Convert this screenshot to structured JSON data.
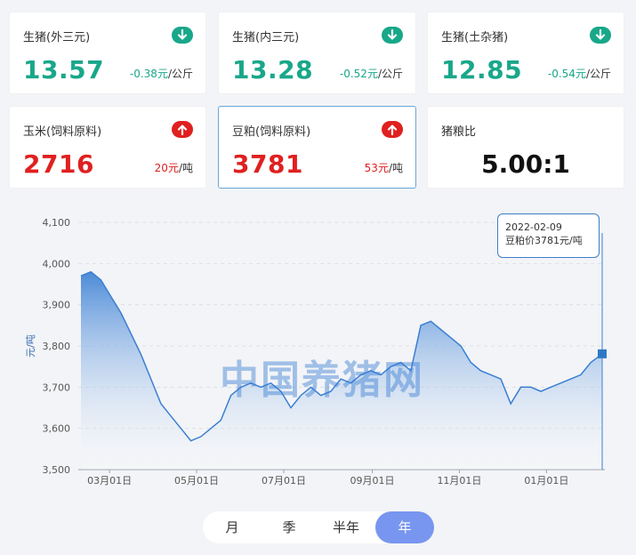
{
  "cards": [
    {
      "name": "生猪(外三元)",
      "value": "13.57",
      "change": "-0.38元",
      "unit": "/公斤",
      "trend": "down"
    },
    {
      "name": "生猪(内三元)",
      "value": "13.28",
      "change": "-0.52元",
      "unit": "/公斤",
      "trend": "down"
    },
    {
      "name": "生猪(土杂猪)",
      "value": "12.85",
      "change": "-0.54元",
      "unit": "/公斤",
      "trend": "down"
    },
    {
      "name": "玉米(饲料原料)",
      "value": "2716",
      "change": "20元",
      "unit": "/吨",
      "trend": "up"
    },
    {
      "name": "豆粕(饲料原料)",
      "value": "3781",
      "change": "53元",
      "unit": "/吨",
      "trend": "up"
    },
    {
      "name": "猪粮比",
      "value": "5.00:1"
    }
  ],
  "colors": {
    "down": "#19a78a",
    "up": "#e02020",
    "line": "#3a7fd3",
    "accent": "#7896ef"
  },
  "icons": {
    "down": "arrow-down-circle-icon",
    "up": "arrow-up-circle-icon"
  },
  "watermark": "中国养猪网",
  "tooltip": {
    "date": "2022-02-09",
    "text": "豆粕价3781元/吨"
  },
  "periods": {
    "items": [
      "月",
      "季",
      "半年",
      "年"
    ],
    "selected": "年"
  },
  "chart_data": {
    "type": "area",
    "title": "",
    "xlabel": "",
    "ylabel": "元/吨",
    "ylim": [
      3500,
      4100
    ],
    "yticks": [
      "3,500",
      "3,600",
      "3,700",
      "3,800",
      "3,900",
      "4,000",
      "4,100"
    ],
    "xticks": [
      "03月01日",
      "05月01日",
      "07月01日",
      "09月01日",
      "11月01日",
      "01月01日"
    ],
    "grid": true,
    "x": [
      "2021-02-09",
      "2021-02-16",
      "2021-02-23",
      "2021-03-02",
      "2021-03-09",
      "2021-03-16",
      "2021-03-23",
      "2021-03-30",
      "2021-04-06",
      "2021-04-13",
      "2021-04-20",
      "2021-04-27",
      "2021-05-04",
      "2021-05-11",
      "2021-05-18",
      "2021-05-25",
      "2021-06-01",
      "2021-06-08",
      "2021-06-15",
      "2021-06-22",
      "2021-06-29",
      "2021-07-06",
      "2021-07-13",
      "2021-07-20",
      "2021-07-27",
      "2021-08-03",
      "2021-08-10",
      "2021-08-17",
      "2021-08-24",
      "2021-08-31",
      "2021-09-07",
      "2021-09-14",
      "2021-09-21",
      "2021-09-28",
      "2021-10-05",
      "2021-10-12",
      "2021-10-19",
      "2021-10-26",
      "2021-11-02",
      "2021-11-09",
      "2021-11-16",
      "2021-11-23",
      "2021-11-30",
      "2021-12-07",
      "2021-12-14",
      "2021-12-21",
      "2021-12-28",
      "2022-01-04",
      "2022-01-11",
      "2022-01-18",
      "2022-01-25",
      "2022-02-01",
      "2022-02-09"
    ],
    "series": [
      {
        "values": [
          3970,
          3980,
          3960,
          3920,
          3880,
          3830,
          3780,
          3720,
          3660,
          3630,
          3600,
          3570,
          3580,
          3600,
          3620,
          3680,
          3700,
          3710,
          3700,
          3710,
          3690,
          3650,
          3680,
          3700,
          3680,
          3690,
          3720,
          3710,
          3730,
          3740,
          3730,
          3750,
          3760,
          3740,
          3850,
          3860,
          3840,
          3820,
          3800,
          3760,
          3740,
          3730,
          3720,
          3660,
          3700,
          3700,
          3690,
          3700,
          3710,
          3720,
          3730,
          3760,
          3781
        ]
      }
    ]
  }
}
